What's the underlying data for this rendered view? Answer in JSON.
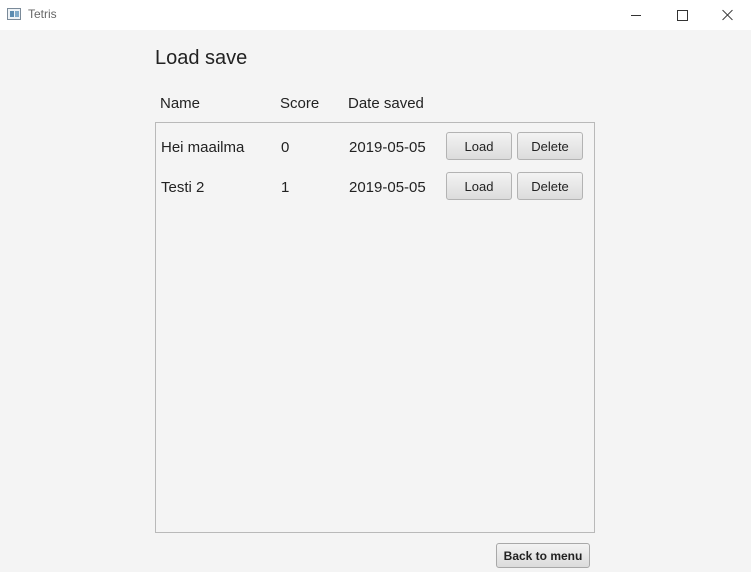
{
  "window": {
    "title": "Tetris",
    "controls": [
      "minimize-icon",
      "maximize-icon",
      "close-icon"
    ]
  },
  "page": {
    "title": "Load save"
  },
  "columns": {
    "name": "Name",
    "score": "Score",
    "date": "Date saved"
  },
  "saves": [
    {
      "name": "Hei maailma",
      "score": "0",
      "date": "2019-05-05",
      "load_label": "Load",
      "delete_label": "Delete"
    },
    {
      "name": "Testi 2",
      "score": "1",
      "date": "2019-05-05",
      "load_label": "Load",
      "delete_label": "Delete"
    }
  ],
  "footer": {
    "back_label": "Back to menu"
  }
}
